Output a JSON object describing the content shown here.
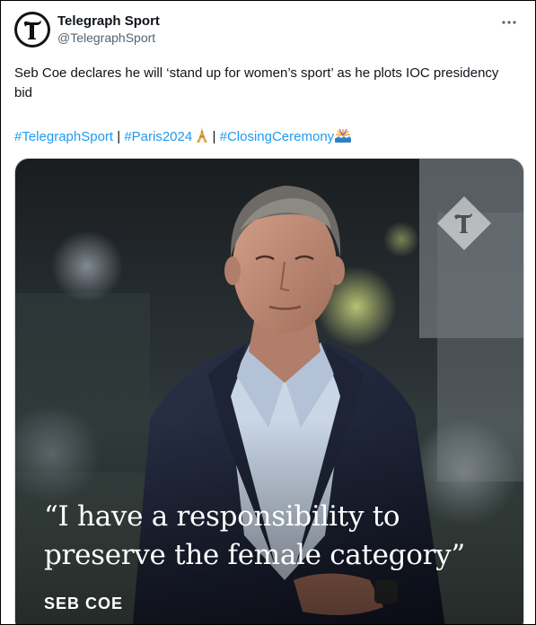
{
  "author": {
    "display_name": "Telegraph Sport",
    "handle": "@TelegraphSport",
    "avatar_icon": "telegraph-t-logo-icon",
    "avatar_bg": "#121212"
  },
  "more_icon": "more-horizontal-icon",
  "tweet": {
    "text": "Seb Coe declares he will ‘stand up for women’s sport’ as he plots IOC presidency bid",
    "hashtags": {
      "telegraph_sport": "#TelegraphSport",
      "sep1": " | ",
      "paris": "#Paris2024",
      "paris_emoji": "eiffel-tower-icon",
      "sep2": " | ",
      "closing": "#ClosingCeremony",
      "closing_emoji": "fireworks-icon"
    },
    "link_color": "#1d9bf0"
  },
  "media": {
    "quote_line1": "“I have a responsibility to",
    "quote_line2": "preserve the female category”",
    "quote_author": "SEB COE",
    "watermark_icon": "telegraph-diamond-logo-icon"
  }
}
